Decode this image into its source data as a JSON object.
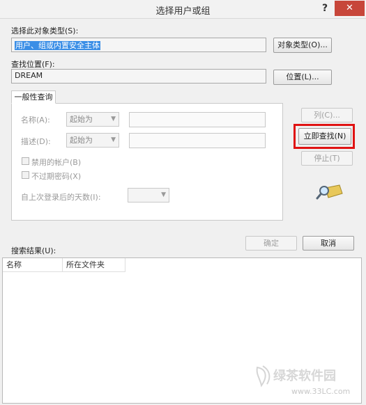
{
  "window": {
    "title": "选择用户或组",
    "help": "?",
    "close": "✕"
  },
  "object_type": {
    "label": "选择此对象类型(S):",
    "value": "用户、组或内置安全主体",
    "button": "对象类型(O)..."
  },
  "location": {
    "label": "查找位置(F):",
    "value": "DREAM",
    "button": "位置(L)..."
  },
  "general_query": {
    "tab": "一般性查询",
    "name_label": "名称(A):",
    "name_mode": "起始为",
    "desc_label": "描述(D):",
    "desc_mode": "起始为",
    "disabled_accounts": "禁用的帐户(B)",
    "non_expiring_password": "不过期密码(X)",
    "days_since_logon": "自上次登录后的天数(I):"
  },
  "side_buttons": {
    "columns": "列(C)...",
    "find_now": "立即查找(N)",
    "stop": "停止(T)"
  },
  "actions": {
    "ok": "确定",
    "cancel": "取消"
  },
  "results": {
    "label": "搜索结果(U):",
    "columns": [
      "名称",
      "所在文件夹"
    ]
  },
  "watermark": {
    "logo": "绿茶软件园",
    "url": "www.33LC.com"
  },
  "colors": {
    "highlight": "#e01212",
    "selection": "#3a8ee6",
    "close": "#c7463a"
  },
  "icons": {
    "search_icon": "magnifier-over-folder-icon"
  }
}
